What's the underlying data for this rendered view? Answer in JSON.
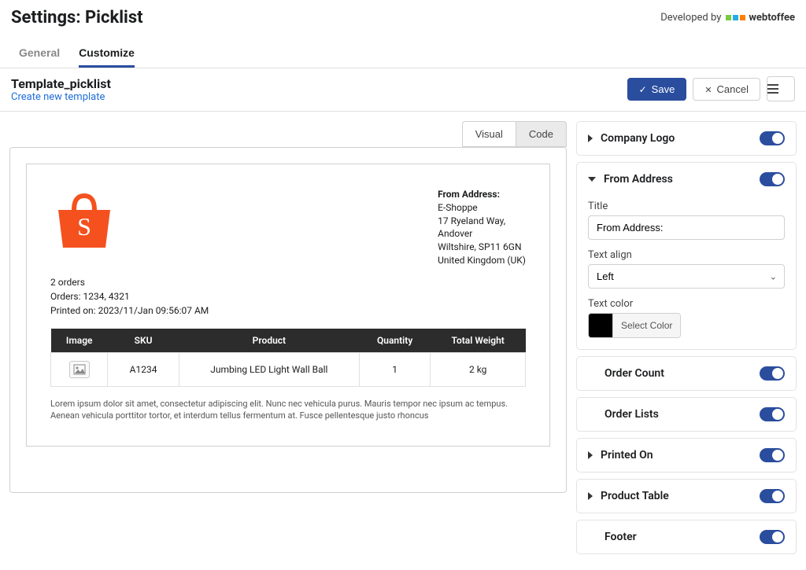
{
  "header": {
    "title": "Settings: Picklist",
    "developed_by": "Developed by",
    "brand": "webtoffee"
  },
  "tabs": {
    "general": "General",
    "customize": "Customize"
  },
  "toolbar": {
    "template_name": "Template_picklist",
    "create_new": "Create new template",
    "save": "Save",
    "cancel": "Cancel"
  },
  "editor_tabs": {
    "visual": "Visual",
    "code": "Code"
  },
  "preview": {
    "from_title": "From Address:",
    "from_lines": [
      "E-Shoppe",
      "17 Ryeland Way,",
      "Andover",
      "Wiltshire, SP11 6GN",
      "United Kingdom (UK)"
    ],
    "orders_count": "2 orders",
    "orders_line": "Orders: 1234, 4321",
    "printed_on": "Printed on: 2023/11/Jan 09:56:07 AM",
    "table_headers": [
      "Image",
      "SKU",
      "Product",
      "Quantity",
      "Total Weight"
    ],
    "table_rows": [
      {
        "sku": "A1234",
        "product": "Jumbing LED Light Wall Ball",
        "quantity": "1",
        "weight": "2 kg"
      }
    ],
    "footer": "Lorem ipsum dolor sit amet, consectetur adipiscing elit. Nunc nec vehicula purus. Mauris tempor nec ipsum ac tempus. Aenean vehicula porttitor tortor, et interdum tellus fermentum at. Fusce pellentesque justo rhoncus"
  },
  "panels": {
    "company_logo": "Company Logo",
    "from_address": "From Address",
    "order_count": "Order Count",
    "order_lists": "Order Lists",
    "printed_on": "Printed On",
    "product_table": "Product Table",
    "footer": "Footer"
  },
  "from_address_form": {
    "title_label": "Title",
    "title_value": "From Address:",
    "text_align_label": "Text align",
    "text_align_value": "Left",
    "text_color_label": "Text color",
    "text_color_value": "#000000",
    "select_color": "Select Color"
  }
}
